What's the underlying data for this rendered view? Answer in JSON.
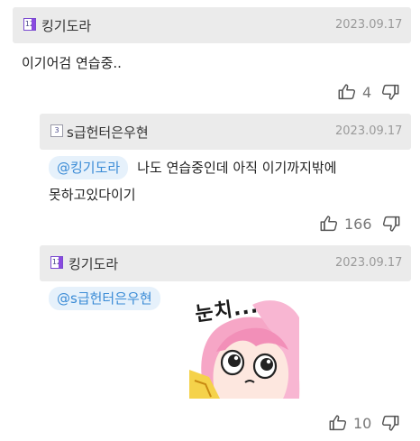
{
  "comments": [
    {
      "author": "킹기도라",
      "date": "2023.09.17",
      "text": "이기어검 연습중..",
      "upvotes": "4"
    },
    {
      "author": "s급헌터은우현",
      "date": "2023.09.17",
      "mention": "@킹기도라",
      "text_line1": "나도 연습중인데 아직 이기까지밖에",
      "text_line2": "못하고있다이기",
      "upvotes": "166"
    },
    {
      "author": "킹기도라",
      "date": "2023.09.17",
      "mention": "@s급헌터은우현",
      "sticker_text": "눈치...",
      "upvotes": "10"
    }
  ],
  "colors": {
    "header_bg": "#ebebeb",
    "mention_bg": "#e6f1fb",
    "mention_text": "#3a8bd6",
    "sticker_hair": "#f6a6c6",
    "sticker_shirt": "#f5d24a"
  },
  "icons": [
    "level-badge-icon",
    "thumbs-up-icon",
    "thumbs-down-icon"
  ]
}
